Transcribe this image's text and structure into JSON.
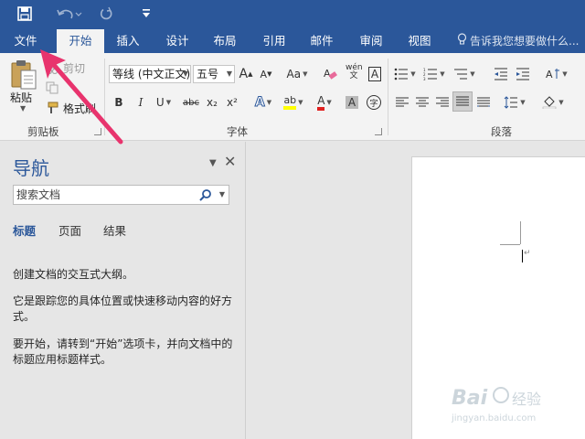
{
  "quick_access": {
    "save_icon": "save-icon",
    "undo_icon": "undo-icon",
    "redo_icon": "redo-icon",
    "customize_icon": "customize-icon"
  },
  "tabs": [
    {
      "label": "文件"
    },
    {
      "label": "开始"
    },
    {
      "label": "插入"
    },
    {
      "label": "设计"
    },
    {
      "label": "布局"
    },
    {
      "label": "引用"
    },
    {
      "label": "邮件"
    },
    {
      "label": "审阅"
    },
    {
      "label": "视图"
    }
  ],
  "tell_me": {
    "text": "告诉我您想要做什么..."
  },
  "clipboard": {
    "paste_label": "粘贴",
    "cut_label": "剪切",
    "format_painter_label": "格式刷",
    "group_label": "剪贴板"
  },
  "font": {
    "font_name": "等线 (中文正文)",
    "font_size": "五号",
    "grow_label": "A",
    "shrink_label": "A",
    "case_label": "Aa",
    "bold_label": "B",
    "italic_label": "I",
    "underline_label": "U",
    "strike_label": "abc",
    "subscript_label": "x₂",
    "superscript_label": "x²",
    "effects_label": "A",
    "highlight_label": "ab",
    "color_label": "A",
    "shade_label": "A",
    "pinyin_label": "wén 文",
    "border_label": "A",
    "circle_label": "字",
    "group_label": "字体"
  },
  "paragraph": {
    "group_label": "段落"
  },
  "nav": {
    "title": "导航",
    "search_placeholder": "搜索文档",
    "tabs": [
      {
        "label": "标题"
      },
      {
        "label": "页面"
      },
      {
        "label": "结果"
      }
    ],
    "text1": "创建文档的交互式大纲。",
    "text2": "它是跟踪您的具体位置或快速移动内容的好方式。",
    "text3": "要开始，请转到“开始”选项卡，并向文档中的标题应用标题样式。"
  },
  "colors": {
    "accent": "#2b579a",
    "annotation_arrow": "#e8336d",
    "highlight_yellow": "#ffff00",
    "font_red": "#e0201f"
  }
}
